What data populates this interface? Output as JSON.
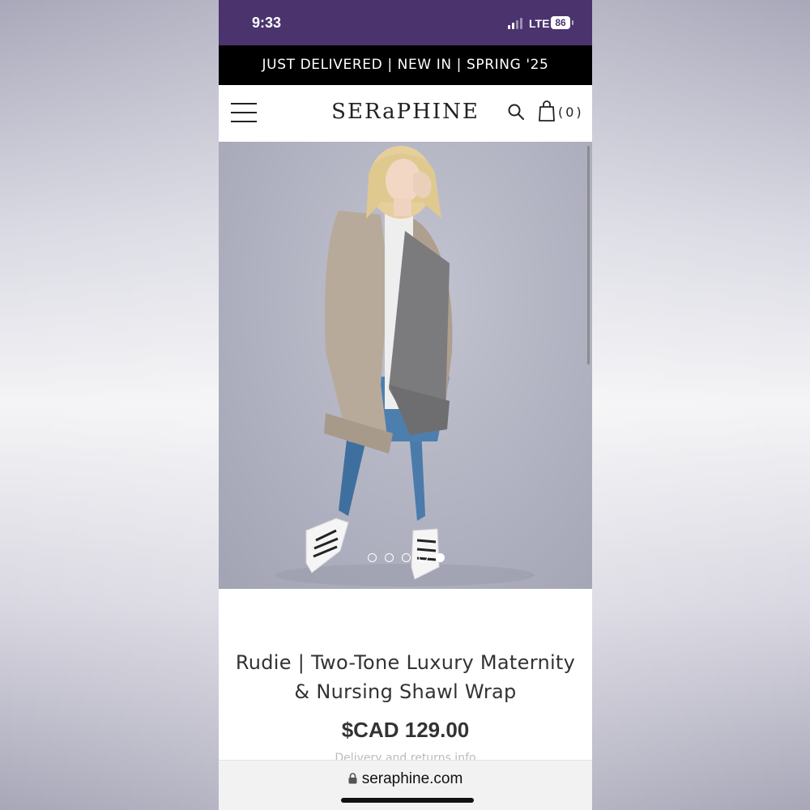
{
  "status_bar": {
    "time": "9:33",
    "network": "LTE",
    "battery": "86"
  },
  "announcement": {
    "text": "JUST DELIVERED | NEW IN | SPRING '25"
  },
  "header": {
    "logo": "SERaPHINE",
    "cart_count": "(0)",
    "icons": [
      "menu-icon",
      "search-icon",
      "shopping-bag-icon"
    ]
  },
  "carousel": {
    "total_images": 5,
    "active_index": 4
  },
  "product": {
    "title_line1": "Rudie | Two-Tone Luxury Maternity",
    "title_line2": "& Nursing Shawl Wrap",
    "price": "$CAD 129.00",
    "partial_text": "Delivery and returns info"
  },
  "browser": {
    "url": "seraphine.com"
  },
  "colors": {
    "status_bar_bg": "#4b336e",
    "announcement_bg": "#000000",
    "page_bg": "#ffffff"
  }
}
